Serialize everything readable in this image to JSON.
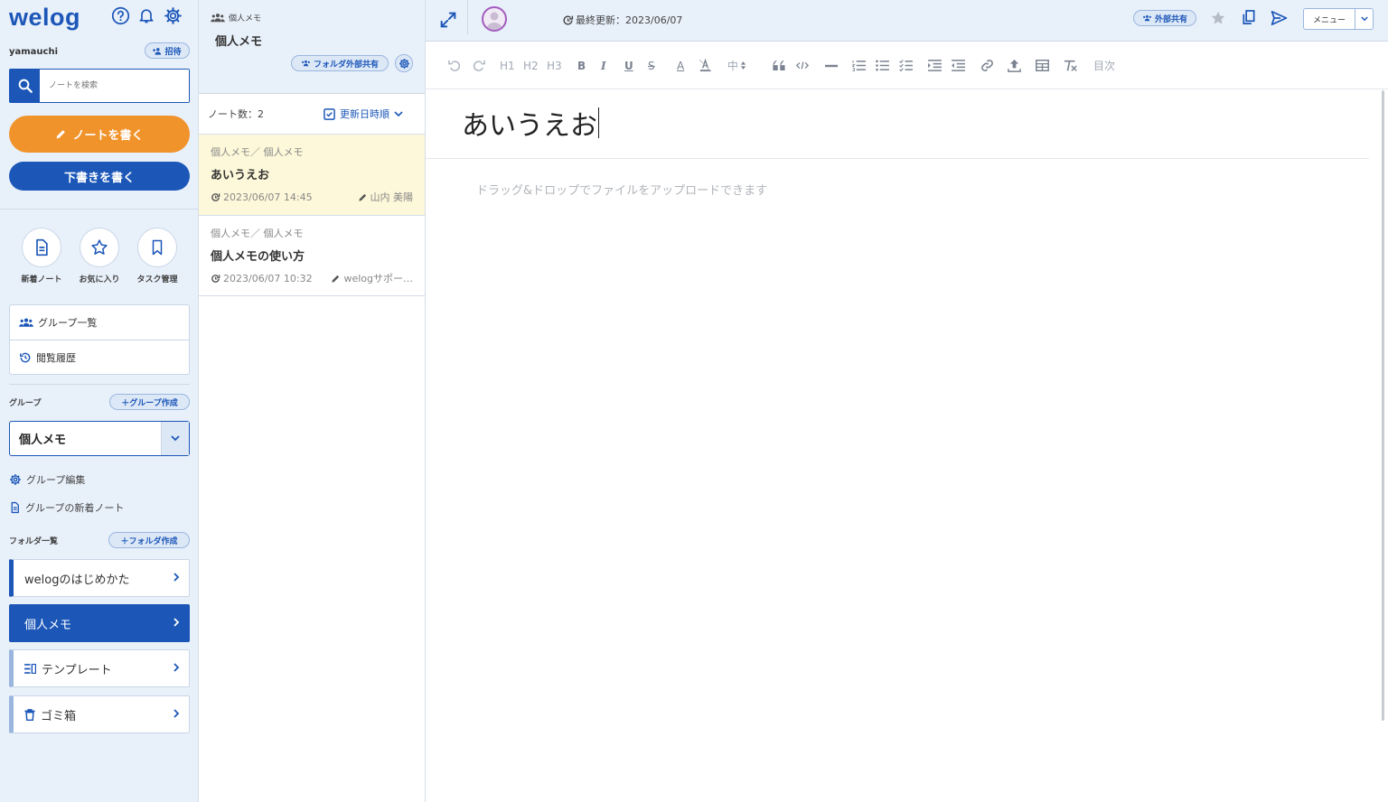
{
  "sidebar": {
    "logo": "welog",
    "username": "yamauchi",
    "invite_label": "招待",
    "search": {
      "placeholder": "ノートを検索"
    },
    "write_note_label": "ノートを書く",
    "write_draft_label": "下書きを書く",
    "quick_links": [
      {
        "label": "新着ノート",
        "icon": "new-note-icon"
      },
      {
        "label": "お気に入り",
        "icon": "star-icon"
      },
      {
        "label": "タスク管理",
        "icon": "bookmark-icon"
      }
    ],
    "menu": [
      {
        "label": "グループ一覧",
        "icon": "group-icon"
      },
      {
        "label": "閲覧履歴",
        "icon": "history-icon"
      }
    ],
    "group_section_label": "グループ",
    "create_group_label": "＋グループ作成",
    "selected_group": "個人メモ",
    "group_edit_label": "グループ編集",
    "group_new_notes_label": "グループの新着ノート",
    "folder_section_label": "フォルダ一覧",
    "create_folder_label": "＋フォルダ作成",
    "folders": [
      {
        "label": "welogのはじめかた",
        "active": false
      },
      {
        "label": "個人メモ",
        "active": true
      },
      {
        "label": "テンプレート",
        "active": false,
        "icon": "template-icon"
      },
      {
        "label": "ゴミ箱",
        "active": false,
        "icon": "trash-icon"
      }
    ]
  },
  "notelist": {
    "breadcrumb": "個人メモ",
    "title": "個人メモ",
    "share_label": "フォルダ外部共有",
    "count_label": "ノート数：2",
    "sort_label": "更新日時順",
    "notes": [
      {
        "path": "個人メモ／ 個人メモ",
        "title": "あいうえお",
        "updated": "2023/06/07 14:45",
        "author": "山内 美陽",
        "selected": true
      },
      {
        "path": "個人メモ／ 個人メモ",
        "title": "個人メモの使い方",
        "updated": "2023/06/07 10:32",
        "author": "welogサポー…",
        "selected": false
      }
    ]
  },
  "editor": {
    "last_updated": "最終更新：2023/06/07",
    "external_share_label": "外部共有",
    "menu_label": "メニュー",
    "toolbar": {
      "h1": "H1",
      "h2": "H2",
      "h3": "H3",
      "bold": "B",
      "italic": "I",
      "underline": "U",
      "strike": "S",
      "font_color": "A",
      "font_size": "中",
      "toc": "目次"
    },
    "doc_title": "あいうえお",
    "drop_hint": "ドラッグ&ドロップでファイルをアップロードできます"
  },
  "colors": {
    "brand_blue": "#1c57b8",
    "accent_orange": "#f0932b",
    "panel_bg": "#e8f0fa",
    "selected_note_bg": "#fdf8d9"
  }
}
